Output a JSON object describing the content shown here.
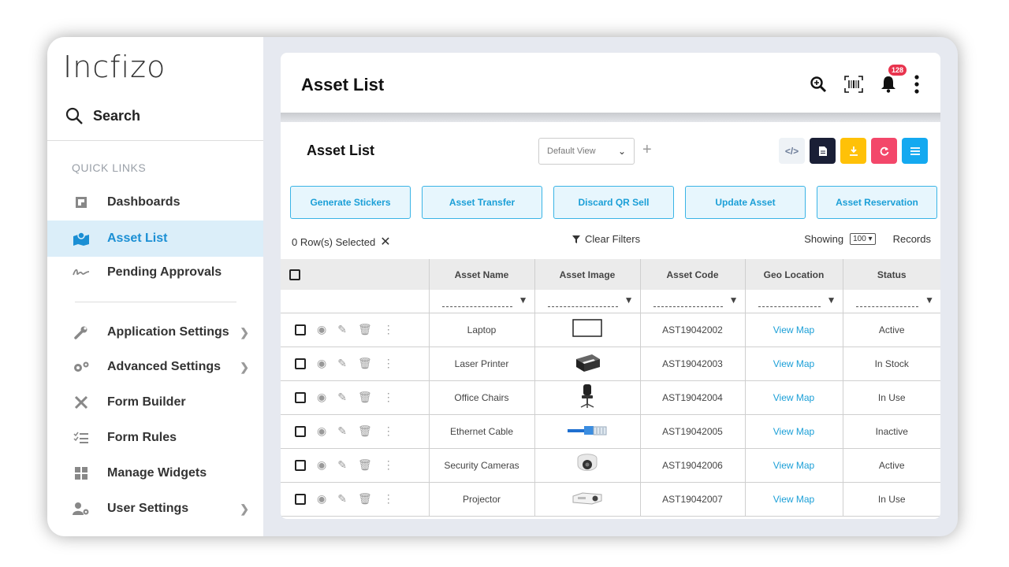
{
  "brand": {
    "logo_text": "Incfizo"
  },
  "sidebar": {
    "search_label": "Search",
    "quick_links_label": "QUICK LINKS",
    "items": [
      {
        "label": "Dashboards",
        "icon": "dashboard-icon",
        "active": false
      },
      {
        "label": "Asset List",
        "icon": "map-icon",
        "active": true
      },
      {
        "label": "Pending Approvals",
        "icon": "signature-icon",
        "active": false
      },
      {
        "label": "Application Settings",
        "icon": "wrench-icon",
        "active": false
      },
      {
        "label": "Advanced Settings",
        "icon": "gears-icon",
        "active": false
      },
      {
        "label": "Form Builder",
        "icon": "tools-icon",
        "active": false
      },
      {
        "label": "Form Rules",
        "icon": "checklist-icon",
        "active": false
      },
      {
        "label": "Manage Widgets",
        "icon": "widgets-icon",
        "active": false
      },
      {
        "label": "User Settings",
        "icon": "user-gear-icon",
        "active": false
      }
    ]
  },
  "header": {
    "title": "Asset List",
    "notification_count": "128"
  },
  "toolbar": {
    "title": "Asset List",
    "view_select": "Default View",
    "plus": "+",
    "actions": [
      "Generate Stickers",
      "Asset Transfer",
      "Discard QR Sell",
      "Update Asset",
      "Asset Reservation"
    ]
  },
  "table_status": {
    "selected": "0 Row(s) Selected",
    "clear_filters": "Clear Filters",
    "showing": "Showing",
    "page_size": "100",
    "records": "Records"
  },
  "table": {
    "columns": [
      "Asset Name",
      "Asset Image",
      "Asset Code",
      "Geo Location",
      "Status"
    ],
    "rows": [
      {
        "name": "Laptop",
        "image": "laptop-image",
        "code": "AST19042002",
        "geo": "View Map",
        "status": "Active"
      },
      {
        "name": "Laser Printer",
        "image": "printer-image",
        "code": "AST19042003",
        "geo": "View Map",
        "status": "In Stock"
      },
      {
        "name": "Office Chairs",
        "image": "chair-image",
        "code": "AST19042004",
        "geo": "View Map",
        "status": "In Use"
      },
      {
        "name": "Ethernet Cable",
        "image": "cable-image",
        "code": "AST19042005",
        "geo": "View Map",
        "status": "Inactive"
      },
      {
        "name": "Security Cameras",
        "image": "camera-image",
        "code": "AST19042006",
        "geo": "View Map",
        "status": "Active"
      },
      {
        "name": "Projector",
        "image": "projector-image",
        "code": "AST19042007",
        "geo": "View Map",
        "status": "In Use"
      }
    ]
  },
  "colors": {
    "accent": "#1b9fd7",
    "active_bg": "#dbeef9",
    "badge": "#e8344e"
  }
}
